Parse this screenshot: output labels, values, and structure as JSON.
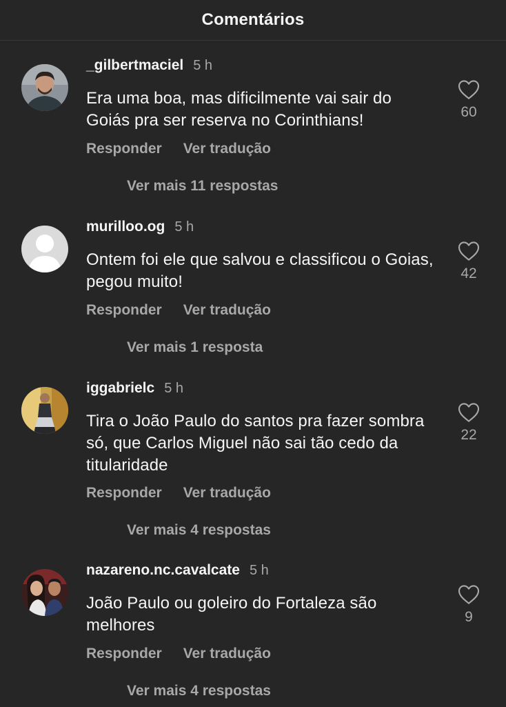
{
  "header": {
    "title": "Comentários"
  },
  "labels": {
    "reply": "Responder",
    "translate": "Ver tradução"
  },
  "comments": [
    {
      "username": "_gilbertmaciel",
      "time": "5 h",
      "text": "Era uma boa, mas dificilmente vai sair do Goiás pra ser reserva no Corinthians!",
      "likes": "60",
      "more_replies": "Ver mais 11 respostas"
    },
    {
      "username": "murilloo.og",
      "time": "5 h",
      "text": "Ontem foi ele que salvou e classificou o Goias, pegou muito!",
      "likes": "42",
      "more_replies": "Ver mais 1 resposta"
    },
    {
      "username": "iggabrielc",
      "time": "5 h",
      "text": "Tira o João Paulo do santos pra fazer sombra só, que Carlos Miguel não sai tão cedo da titularidade",
      "likes": "22",
      "more_replies": "Ver mais 4 respostas"
    },
    {
      "username": "nazareno.nc.cavalcate",
      "time": "5 h",
      "text": "João Paulo ou goleiro do Fortaleza são melhores",
      "likes": "9",
      "more_replies": "Ver mais 4 respostas"
    }
  ],
  "colors": {
    "background": "#262626",
    "text_primary": "#f5f5f5",
    "text_secondary": "#a8a8a8",
    "divider": "#363636"
  },
  "icons": {
    "like": "heart-outline-icon"
  }
}
